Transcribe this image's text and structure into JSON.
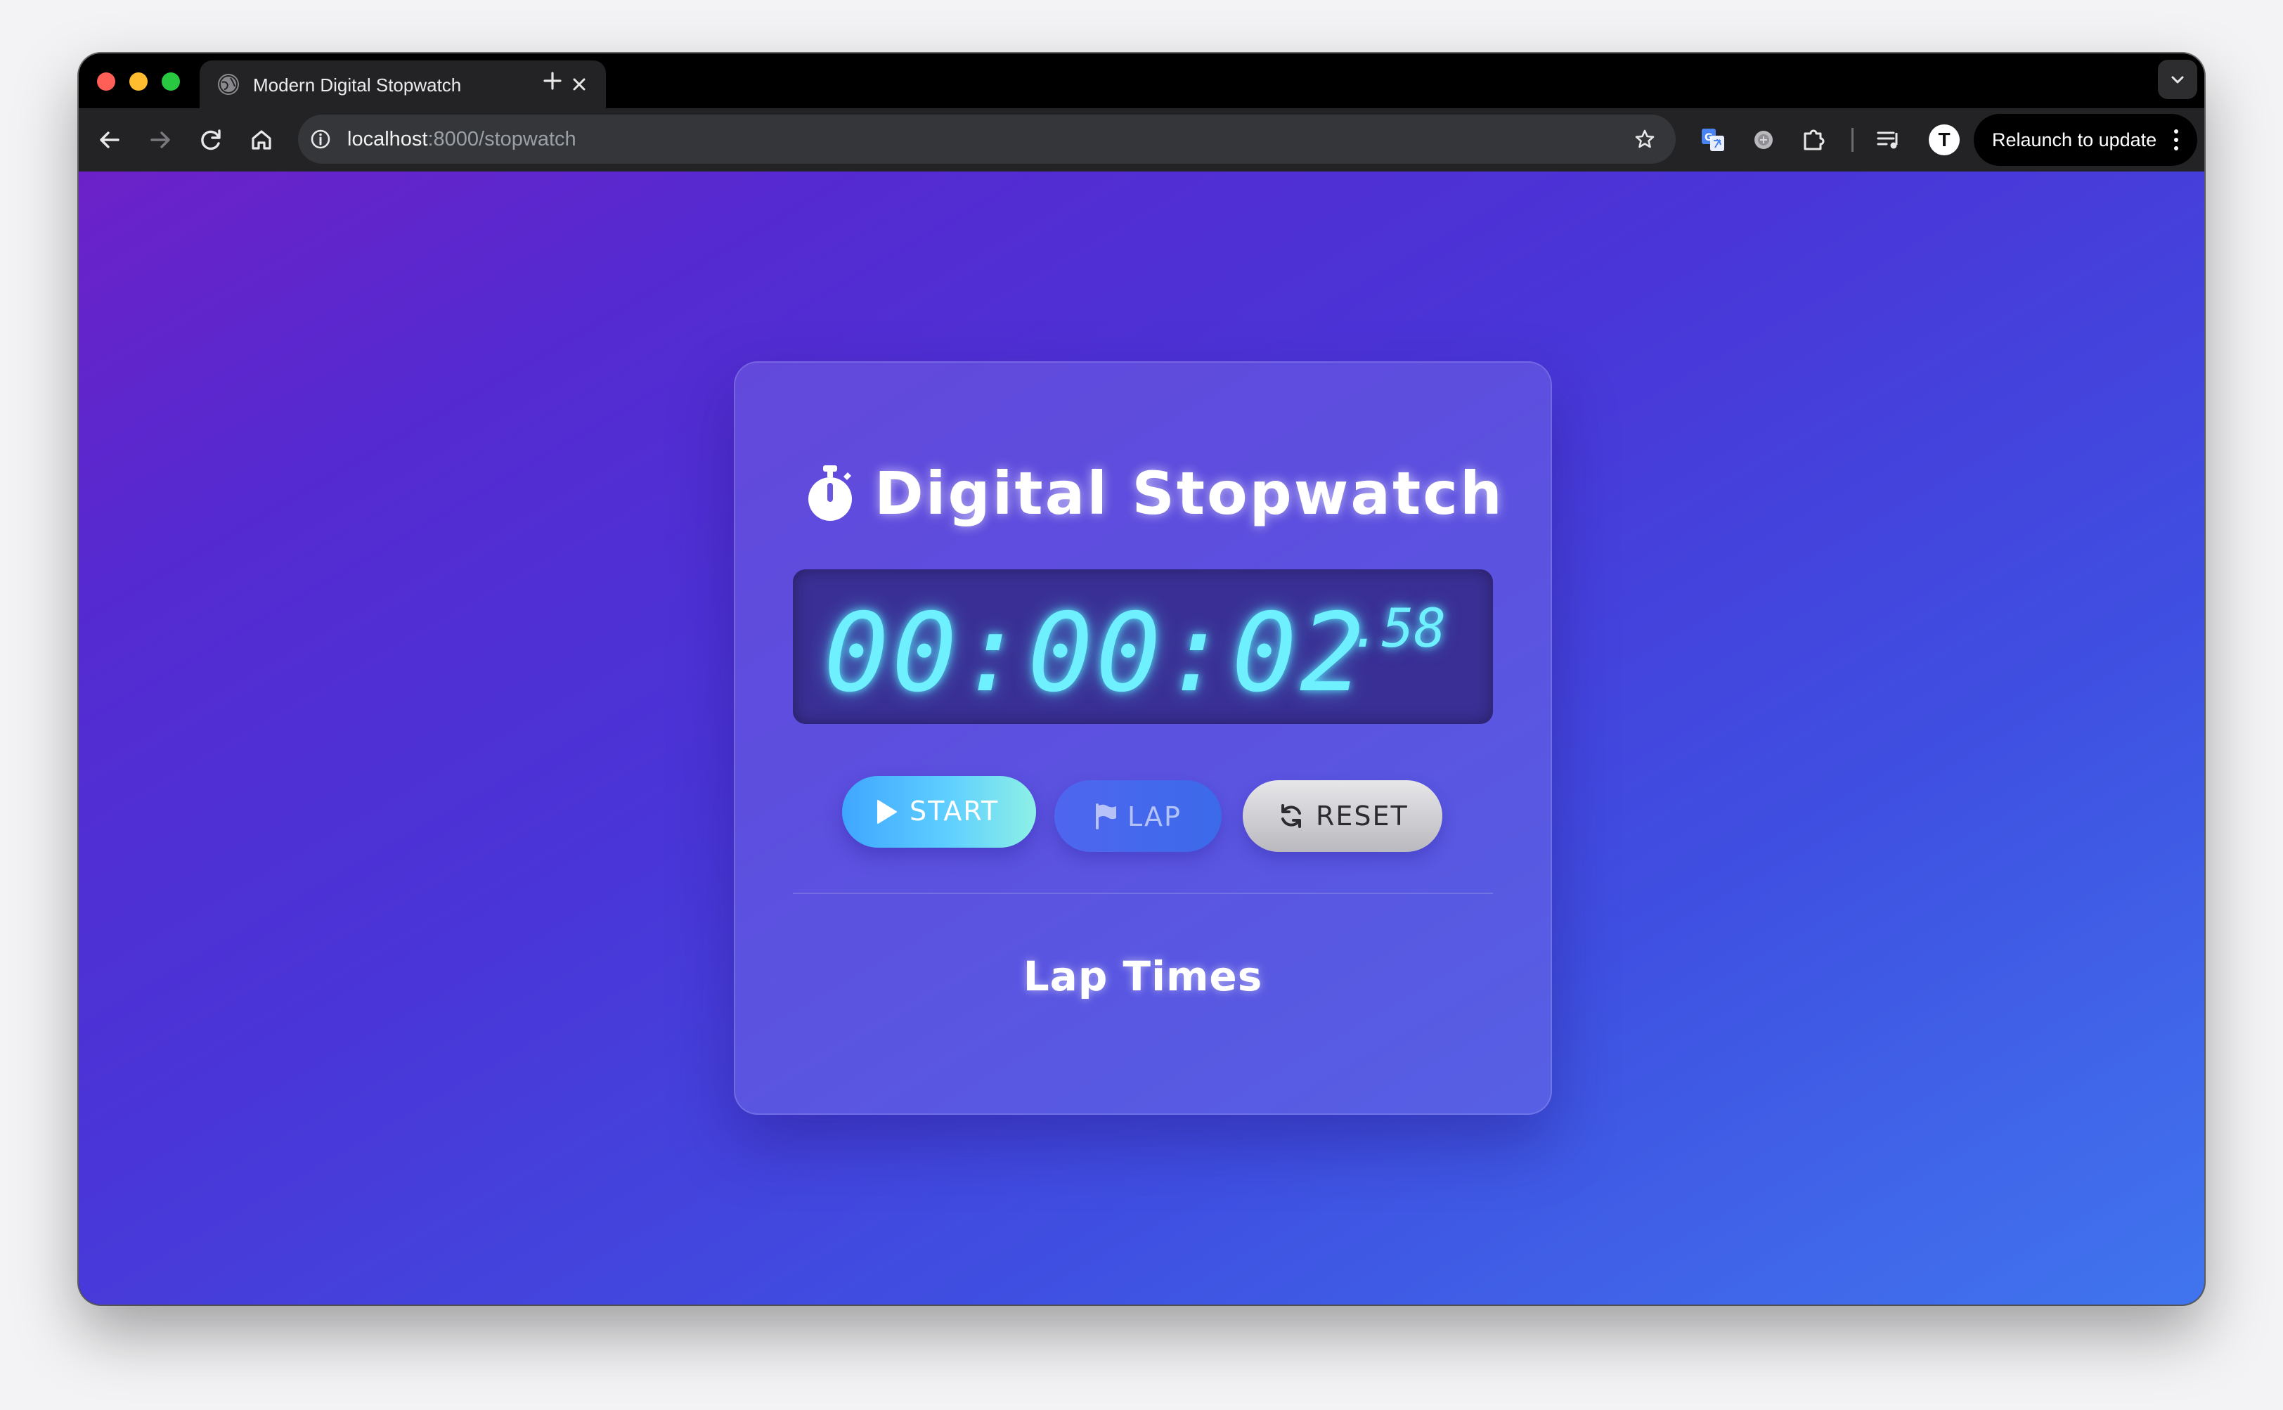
{
  "browser": {
    "tab": {
      "title": "Modern Digital Stopwatch",
      "favicon": "globe-icon"
    },
    "address_bar": {
      "host": "localhost",
      "path": ":8000/stopwatch"
    },
    "relaunch_label": "Relaunch to update",
    "profile_initial": "T",
    "toolbar_icons": [
      "back-arrow-icon",
      "forward-arrow-icon",
      "reload-icon",
      "home-icon",
      "info-icon",
      "star-icon",
      "translate-icon",
      "extension-circle-icon",
      "puzzle-icon",
      "media-queue-icon",
      "kebab-menu-icon"
    ]
  },
  "stopwatch": {
    "title": "Digital Stopwatch",
    "title_icon": "stopwatch-icon",
    "time_main": "00:00:02",
    "time_centiseconds": ".58",
    "buttons": {
      "start": "START",
      "lap": "LAP",
      "reset": "RESET"
    },
    "button_icons": [
      "play-icon",
      "flag-icon",
      "refresh-icon"
    ],
    "lap_section_title": "Lap Times",
    "laps": []
  },
  "colors": {
    "display_digits": "#6ff0ff",
    "gradient_start": "#6c21c8",
    "gradient_end": "#4075ee",
    "start_button": "#5fcfff",
    "lap_button": "#4f66ef",
    "reset_button": "#d0d0d4"
  }
}
